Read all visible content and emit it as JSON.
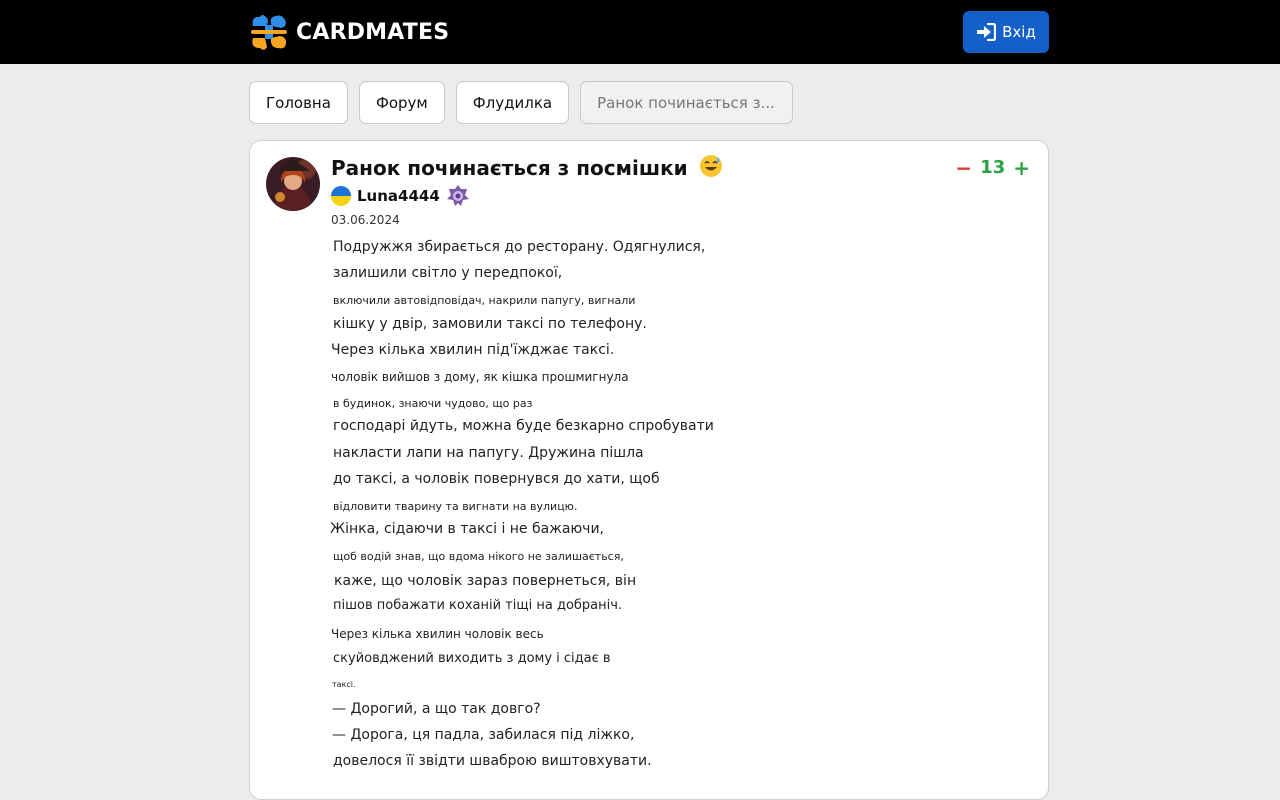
{
  "header": {
    "brand": "CARDMATES",
    "login_label": "Вхід"
  },
  "breadcrumbs": [
    {
      "label": "Головна"
    },
    {
      "label": "Форум"
    },
    {
      "label": "Флудилка"
    },
    {
      "label": "Ранок починається з..."
    }
  ],
  "post": {
    "title": "Ранок починається з посмішки",
    "author": "Luna4444",
    "date": "03.06.2024",
    "score": "13",
    "vote_minus": "−",
    "vote_plus": "+",
    "image_text": [
      "Подружжя збирається до ресторану. Одягнулися,",
      "залишили світло у передпокої,",
      "включили автовідповідач, накрили папугу, вигнали",
      "кішку у двір, замовили таксі по телефону.",
      "Через кілька              хвилин під'їжджає таксі.",
      "чоловік вийшов з дому, як кішка прошмигнула",
      "в будинок, знаючи чудово, що раз",
      "господарі йдуть, можна буде безкарно спробувати",
      "накласти лапи на папугу. Дружина пішла",
      "до таксі, а чоловік повернувся до хати, щоб",
      "відловити тварину та вигнати на вулицю.",
      "Жінка, сідаючи в таксі і не бажаючи,",
      "щоб водій знав, що вдома нікого не залишається,",
      "каже, що чоловік зараз повернеться, він",
      "пішов побажати коханій тіщі на добраніч.",
      "Через кілька хвилин чоловік весь",
      "скуйовджений виходить з дому і сідає в",
      "таксі.",
      "—      Дорогий, а що так довго?",
      "— Дорога, ця падла, забилася під ліжко,",
      "довелося її звідти шваброю виштовхувати."
    ]
  },
  "colors": {
    "topbar": "#000000",
    "login_button": "#1560c8",
    "vote_minus": "#e03a2f",
    "vote_plus": "#2aa243",
    "logo_orange": "#f5a623",
    "logo_blue": "#2f8fe6"
  },
  "icons": {
    "logo": "cardmates-logo-icon",
    "login": "sign-in-icon",
    "title_emoji": "grinning-sweat-emoji",
    "flag": "ukraine-flag-icon",
    "badge": "rank-badge-icon"
  }
}
